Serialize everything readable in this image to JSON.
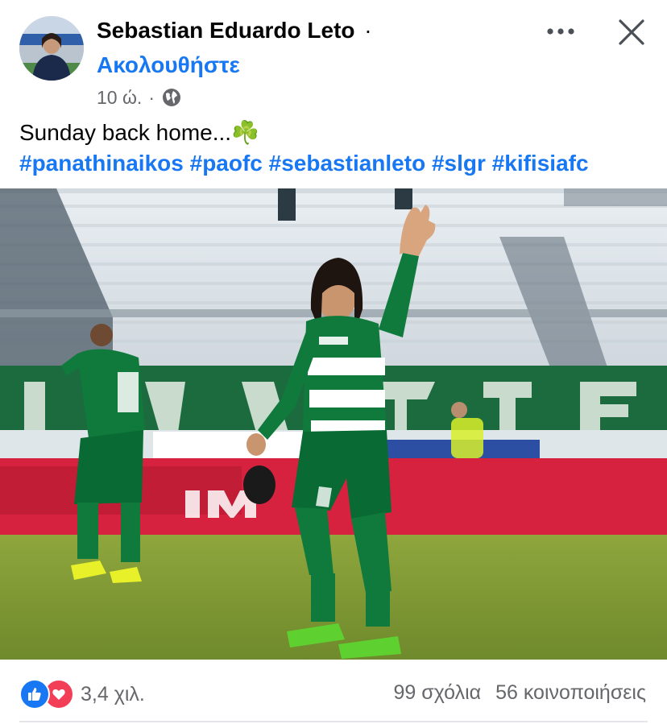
{
  "post": {
    "author": "Sebastian Eduardo Leto",
    "name_separator": "·",
    "follow_label": "Ακολουθήστε",
    "timestamp": "10 ώ.",
    "meta_separator": "·",
    "audience_icon": "globe-icon",
    "caption_text": "Sunday back home...",
    "caption_emoji": "☘️",
    "hashtags": [
      "#panathinaikos",
      "#paofc",
      "#sebastianleto",
      "#slgr",
      "#kifisiafc"
    ]
  },
  "header_actions": {
    "more_icon": "more-icon",
    "close_icon": "close-icon"
  },
  "footer": {
    "reaction_icons": [
      "like-icon",
      "love-icon"
    ],
    "reaction_count": "3,4 χιλ.",
    "comments": "99 σχόλια",
    "shares": "56 κοινοποιήσεις"
  },
  "colors": {
    "link_blue": "#1877f2",
    "meta_gray": "#65676b",
    "love_red": "#f33e58",
    "kit_green": "#0f7a3c"
  }
}
